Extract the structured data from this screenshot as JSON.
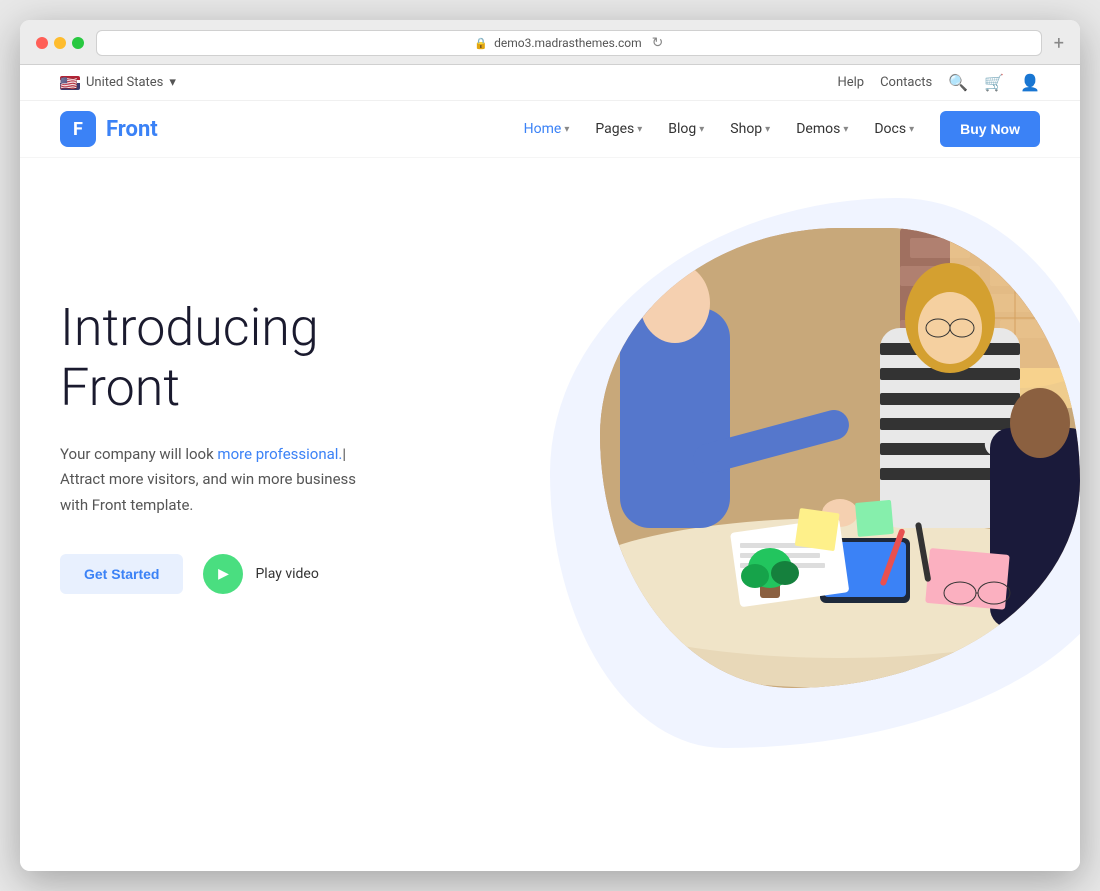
{
  "browser": {
    "address": "demo3.madrasthemes.com",
    "lock_symbol": "🔒",
    "refresh_symbol": "↻",
    "new_tab": "+"
  },
  "topbar": {
    "locale": "United States",
    "chevron": "▾",
    "help": "Help",
    "contacts": "Contacts"
  },
  "nav": {
    "logo_letter": "F",
    "logo_name": "Front",
    "links": [
      {
        "label": "Home",
        "has_chevron": true,
        "active": true
      },
      {
        "label": "Pages",
        "has_chevron": true,
        "active": false
      },
      {
        "label": "Blog",
        "has_chevron": true,
        "active": false
      },
      {
        "label": "Shop",
        "has_chevron": true,
        "active": false
      },
      {
        "label": "Demos",
        "has_chevron": true,
        "active": false
      },
      {
        "label": "Docs",
        "has_chevron": true,
        "active": false
      }
    ],
    "buy_now": "Buy Now"
  },
  "hero": {
    "title_line1": "Introducing",
    "title_line2": "Front",
    "description_before": "Your company will look ",
    "description_highlight": "more professional.",
    "description_after": "| Attract more visitors, and win more business with Front template.",
    "get_started": "Get Started",
    "play_video": "Play video"
  }
}
